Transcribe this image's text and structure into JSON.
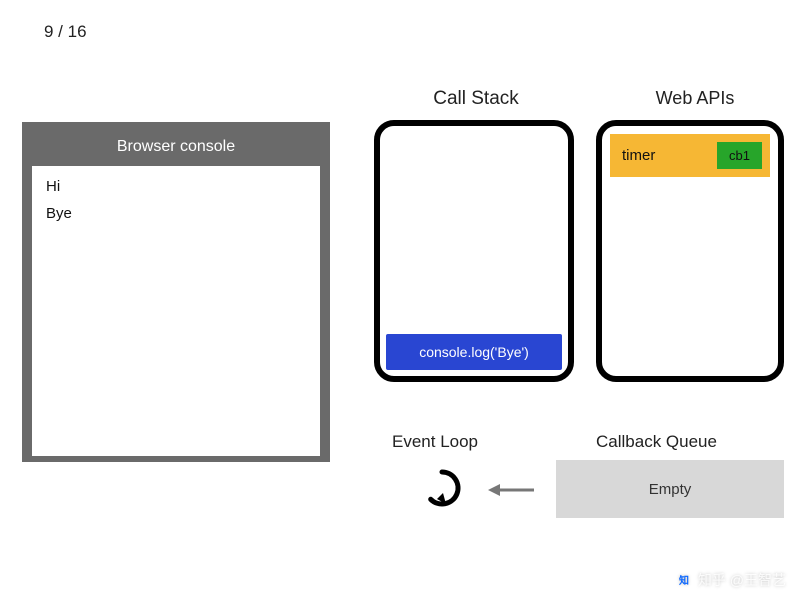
{
  "counter": "9 / 16",
  "console": {
    "title": "Browser console",
    "lines": [
      "Hi",
      "Bye"
    ]
  },
  "callstack": {
    "title": "Call Stack",
    "frames": [
      "console.log('Bye')"
    ]
  },
  "webapis": {
    "title": "Web APIs",
    "items": [
      {
        "label": "timer",
        "callback": "cb1"
      }
    ]
  },
  "eventloop": {
    "title": "Event Loop"
  },
  "queue": {
    "title": "Callback Queue",
    "content": "Empty"
  },
  "watermark": "知乎 @王智艺"
}
